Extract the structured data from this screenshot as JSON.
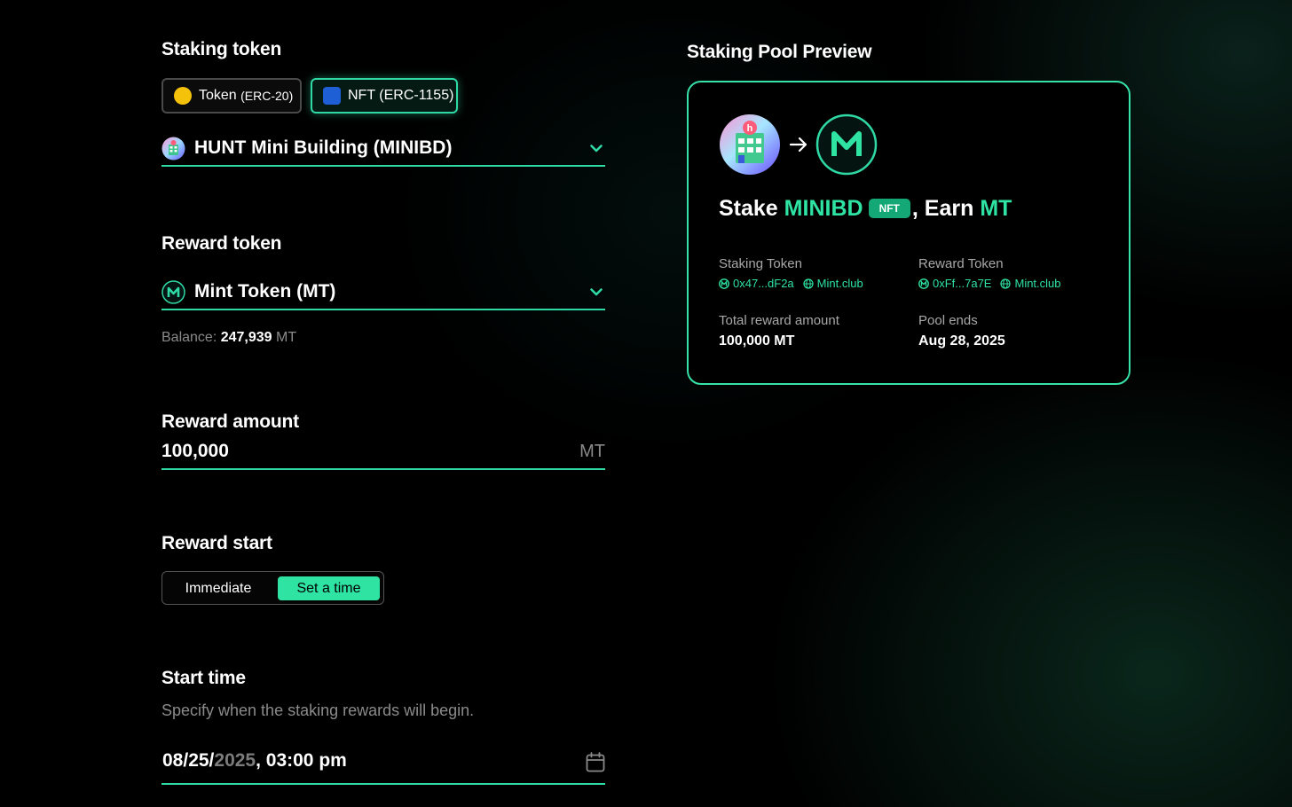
{
  "staking": {
    "label": "Staking token",
    "type_erc20": {
      "main": "Token ",
      "sub": "(ERC-20)"
    },
    "type_erc1155": {
      "main": "NFT (ERC-1155)"
    },
    "selected_token": "HUNT Mini Building (MINIBD)"
  },
  "reward": {
    "label": "Reward token",
    "selected_token": "Mint Token (MT)",
    "balance_label": "Balance: ",
    "balance_value": "247,939",
    "balance_unit": " MT"
  },
  "reward_amount": {
    "label": "Reward amount",
    "value": "100,000",
    "unit": "MT"
  },
  "reward_start": {
    "label": "Reward start",
    "options": [
      "Immediate",
      "Set a time"
    ],
    "selected": "Set a time"
  },
  "start_time": {
    "label": "Start time",
    "help": "Specify when the staking rewards will begin.",
    "value_month_day": "08/25/",
    "value_year": "2025",
    "value_time": ", 03:00 pm"
  },
  "preview": {
    "title": "Staking Pool Preview",
    "heading": {
      "stake_word": "Stake ",
      "stake_token": "MINIBD",
      "badge": "NFT",
      "earn_word": ", Earn ",
      "earn_token": "MT"
    },
    "staking_token": {
      "label": "Staking Token",
      "address": "0x47...dF2a",
      "site": "Mint.club"
    },
    "reward_token": {
      "label": "Reward Token",
      "address": "0xFf...7a7E",
      "site": "Mint.club"
    },
    "total_reward": {
      "label": "Total reward amount",
      "value": "100,000 MT"
    },
    "pool_ends": {
      "label": "Pool ends",
      "value": "Aug 28, 2025"
    }
  },
  "colors": {
    "accent": "#2fd9a4",
    "erc20_dot": "#f5c20b",
    "erc1155_square": "#1f5fd6"
  },
  "icons": {
    "staking_token": "hunt-building-icon",
    "reward_token": "mint-club-m-icon",
    "dropdown": "chevron-down-icon",
    "calendar": "calendar-icon",
    "arrow": "arrow-right-icon",
    "link": "mint-link-icon",
    "globe": "globe-icon"
  }
}
